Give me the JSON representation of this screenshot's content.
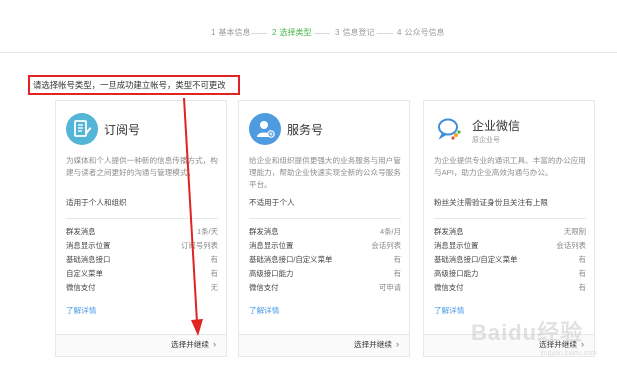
{
  "steps": [
    {
      "num": "1",
      "label": "基本信息",
      "active": false
    },
    {
      "num": "2",
      "label": "选择类型",
      "active": true
    },
    {
      "num": "3",
      "label": "信息登记",
      "active": false
    },
    {
      "num": "4",
      "label": "公众号信息",
      "active": false
    }
  ],
  "notice": "请选择帐号类型，一旦成功建立帐号，类型不可更改",
  "cards": [
    {
      "title": "订阅号",
      "subtitle": "",
      "icon": "subscription-icon",
      "icon_color": "#53b6d6",
      "desc": "为媒体和个人提供一种新的信息传播方式，构建与读者之间更好的沟通与管理模式。",
      "scope": "适用于个人和组织",
      "features": [
        {
          "name": "群发消息",
          "value": "1条/天"
        },
        {
          "name": "消息显示位置",
          "value": "订阅号列表"
        },
        {
          "name": "基础消息接口",
          "value": "有"
        },
        {
          "name": "自定义菜单",
          "value": "有"
        },
        {
          "name": "微信支付",
          "value": "无"
        }
      ],
      "learn_more": "了解详情",
      "select": "选择并继续"
    },
    {
      "title": "服务号",
      "subtitle": "",
      "icon": "service-icon",
      "icon_color": "#4f9be0",
      "desc": "给企业和组织提供更强大的业务服务与用户管理能力，帮助企业快速实现全新的公众号服务平台。",
      "scope": "不适用于个人",
      "features": [
        {
          "name": "群发消息",
          "value": "4条/月"
        },
        {
          "name": "消息显示位置",
          "value": "会话列表"
        },
        {
          "name": "基础消息接口/自定义菜单",
          "value": "有"
        },
        {
          "name": "高级接口能力",
          "value": "有"
        },
        {
          "name": "微信支付",
          "value": "可申请"
        }
      ],
      "learn_more": "了解详情",
      "select": "选择并继续"
    },
    {
      "title": "企业微信",
      "subtitle": "原企业号",
      "icon": "wecom-icon",
      "icon_color": "#3d90d8",
      "desc": "为企业提供专业的通讯工具、丰富的办公应用与API，助力企业高效沟通与办公。",
      "scope": "粉丝关注需验证身份且关注有上限",
      "features": [
        {
          "name": "群发消息",
          "value": "无限制"
        },
        {
          "name": "消息显示位置",
          "value": "会话列表"
        },
        {
          "name": "基础消息接口/自定义菜单",
          "value": "有"
        },
        {
          "name": "高级接口能力",
          "value": "有"
        },
        {
          "name": "微信支付",
          "value": "有"
        }
      ],
      "learn_more": "了解详情",
      "select": "选择并继续"
    }
  ],
  "colors": {
    "accent": "#44b549",
    "link": "#459ae9",
    "highlight": "#e02323"
  },
  "watermark": {
    "text": "Baidu经验",
    "sub": "jingyan.baidu.com"
  }
}
